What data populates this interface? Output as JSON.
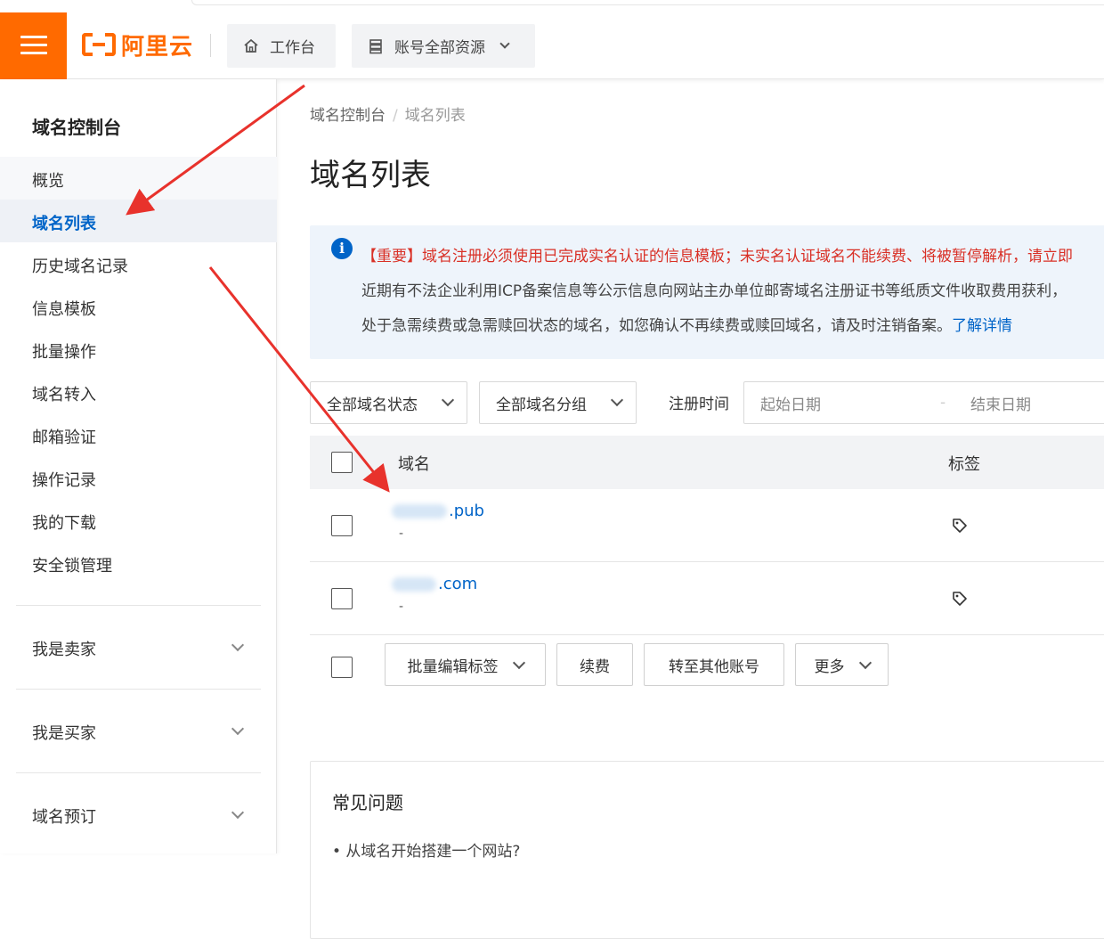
{
  "topbar": {
    "logo_text": "阿里云",
    "workbench_label": "工作台",
    "resources_label": "账号全部资源"
  },
  "sidebar": {
    "title": "域名控制台",
    "items": [
      {
        "label": "概览"
      },
      {
        "label": "域名列表",
        "active": true
      },
      {
        "label": "历史域名记录"
      },
      {
        "label": "信息模板"
      },
      {
        "label": "批量操作"
      },
      {
        "label": "域名转入"
      },
      {
        "label": "邮箱验证"
      },
      {
        "label": "操作记录"
      },
      {
        "label": "我的下载"
      },
      {
        "label": "安全锁管理"
      }
    ],
    "groups": [
      {
        "label": "我是卖家"
      },
      {
        "label": "我是买家"
      },
      {
        "label": "域名预订"
      }
    ]
  },
  "breadcrumb": {
    "root": "域名控制台",
    "separator": "/",
    "current": "域名列表"
  },
  "page_title": "域名列表",
  "notice": {
    "line1": "【重要】域名注册必须使用已完成实名认证的信息模板；未实名认证域名不能续费、将被暂停解析，请立即",
    "line2": "近期有不法企业利用ICP备案信息等公示信息向网站主办单位邮寄域名注册证书等纸质文件收取费用获利，",
    "line3": "处于急需续费或急需赎回状态的域名，如您确认不再续费或赎回域名，请及时注销备案。",
    "link": "了解详情"
  },
  "filters": {
    "status": "全部域名状态",
    "group": "全部域名分组",
    "reg_time_label": "注册时间",
    "start_placeholder": "起始日期",
    "date_sep": "-",
    "end_placeholder": "结束日期"
  },
  "table": {
    "headers": {
      "domain": "域名",
      "tag": "标签"
    },
    "rows": [
      {
        "domain_suffix": ".pub",
        "sub": "-"
      },
      {
        "domain_suffix": ".com",
        "sub": "-"
      }
    ]
  },
  "bulk": {
    "edit_tags": "批量编辑标签",
    "renew": "续费",
    "transfer": "转至其他账号",
    "more": "更多"
  },
  "faq": {
    "title": "常见问题",
    "items": [
      "• 从域名开始搭建一个网站?"
    ]
  },
  "colors": {
    "brand": "#ff6a00",
    "link": "#0064c8",
    "warning": "#d93026",
    "annotation_arrow": "#e8322c"
  }
}
